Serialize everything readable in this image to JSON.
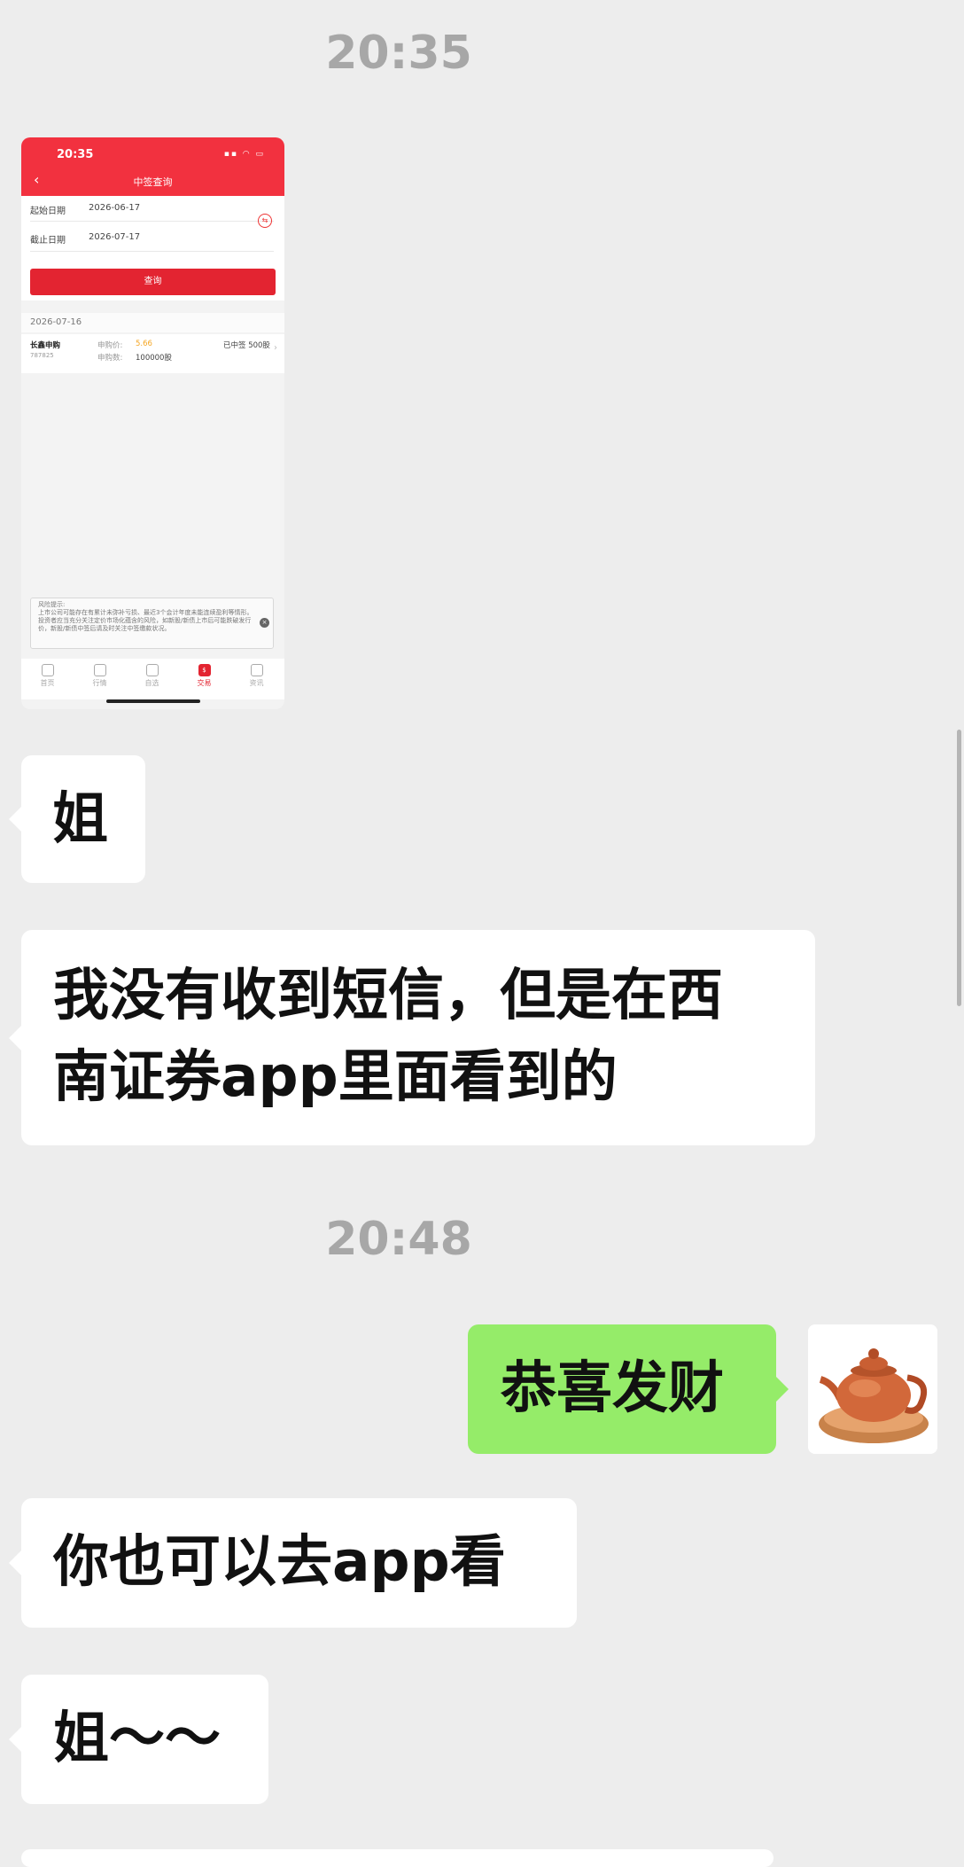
{
  "chat": {
    "timestamp1": "20:35",
    "timestamp2": "20:48",
    "messages": [
      {
        "text": "姐"
      },
      {
        "text": "我没有收到短信，但是在西南证券app里面看到的",
        "line1": "我没有收到短信，但是在西",
        "line2": "南证券app里面看到的"
      },
      {
        "text": "恭喜发财"
      },
      {
        "text": "你也可以去app看"
      },
      {
        "text": "姐～～"
      }
    ]
  },
  "screenshot": {
    "status_time": "20:35",
    "title": "中签查询",
    "start_label": "起始日期",
    "start_value": "2026-06-17",
    "end_label": "截止日期",
    "end_value": "2026-07-17",
    "query_button": "查询",
    "result_date": "2026-07-16",
    "item": {
      "name": "长鑫申购",
      "code": "787825",
      "price_label": "申购价:",
      "price_value": "5.66",
      "qty_label": "申购数:",
      "qty_value": "100000股",
      "status": "已中签 500股"
    },
    "risk_title": "风险提示:",
    "risk_text": "上市公司可能存在有累计未弥补亏损、最近3个会计年度未能连续盈利等情形。投资者应当充分关注定价市场化蕴含的风险，如新股/新债上市后可能跌破发行价，新股/新债中签后请及时关注中签缴款状况。",
    "tabs": [
      "首页",
      "行情",
      "自选",
      "交易",
      "资讯"
    ],
    "active_tab": "交易",
    "accent_color": "#e32431"
  },
  "colors": {
    "background": "#ededed",
    "bubble_in": "#ffffff",
    "bubble_out": "#95ec69",
    "timestamp": "#a7a7a7"
  }
}
